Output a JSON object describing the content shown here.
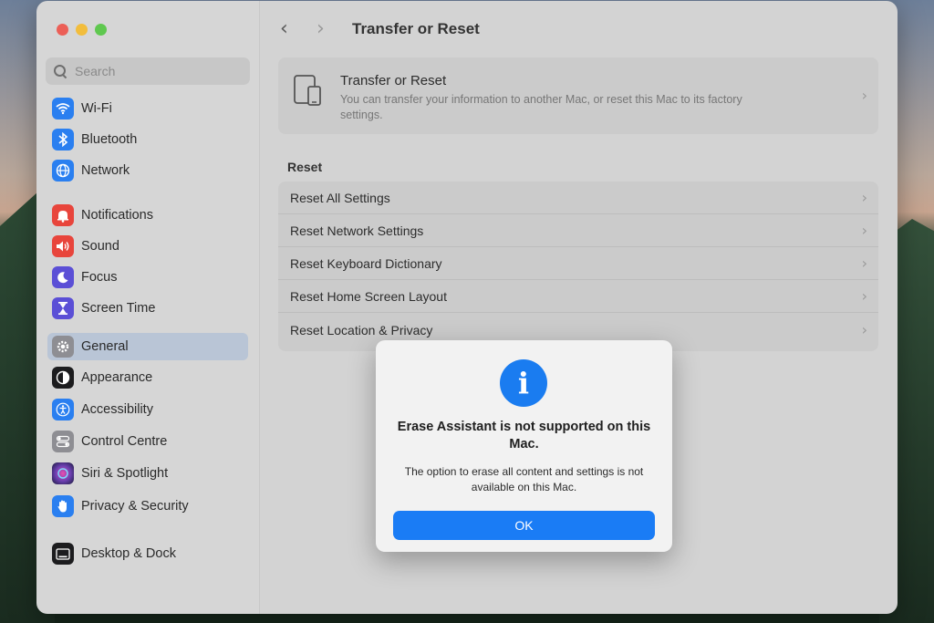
{
  "sidebar": {
    "search_placeholder": "Search",
    "items": [
      {
        "label": "Wi-Fi",
        "icon": "wifi-icon",
        "color": "#2a7ff0"
      },
      {
        "label": "Bluetooth",
        "icon": "bluetooth-icon",
        "color": "#2a7ff0"
      },
      {
        "label": "Network",
        "icon": "globe-icon",
        "color": "#2a7ff0"
      },
      {
        "label": "Notifications",
        "icon": "bell-icon",
        "color": "#e8453c"
      },
      {
        "label": "Sound",
        "icon": "speaker-icon",
        "color": "#e8453c"
      },
      {
        "label": "Focus",
        "icon": "moon-icon",
        "color": "#5b4fd6"
      },
      {
        "label": "Screen Time",
        "icon": "hourglass-icon",
        "color": "#5b4fd6"
      },
      {
        "label": "General",
        "icon": "gear-icon",
        "color": "#8e8e93",
        "selected": true
      },
      {
        "label": "Appearance",
        "icon": "appearance-icon",
        "color": "#1c1c1e"
      },
      {
        "label": "Accessibility",
        "icon": "accessibility-icon",
        "color": "#2a7ff0"
      },
      {
        "label": "Control Centre",
        "icon": "control-centre-icon",
        "color": "#8e8e93"
      },
      {
        "label": "Siri & Spotlight",
        "icon": "siri-icon",
        "color": "#6a3fb0"
      },
      {
        "label": "Privacy & Security",
        "icon": "hand-icon",
        "color": "#2a7ff0"
      },
      {
        "label": "Desktop & Dock",
        "icon": "desktop-icon",
        "color": "#1c1c1e"
      }
    ]
  },
  "toolbar": {
    "title": "Transfer or Reset"
  },
  "card": {
    "title": "Transfer or Reset",
    "description": "You can transfer your information to another Mac, or reset this Mac to its factory settings."
  },
  "reset_section": {
    "label": "Reset",
    "rows": [
      "Reset All Settings",
      "Reset Network Settings",
      "Reset Keyboard Dictionary",
      "Reset Home Screen Layout",
      "Reset Location & Privacy"
    ]
  },
  "dialog": {
    "icon": "info-icon",
    "title": "Erase Assistant is not supported on this Mac.",
    "message": "The option to erase all content and settings is not available on this Mac.",
    "ok_label": "OK",
    "accent": "#1a7cf5"
  }
}
